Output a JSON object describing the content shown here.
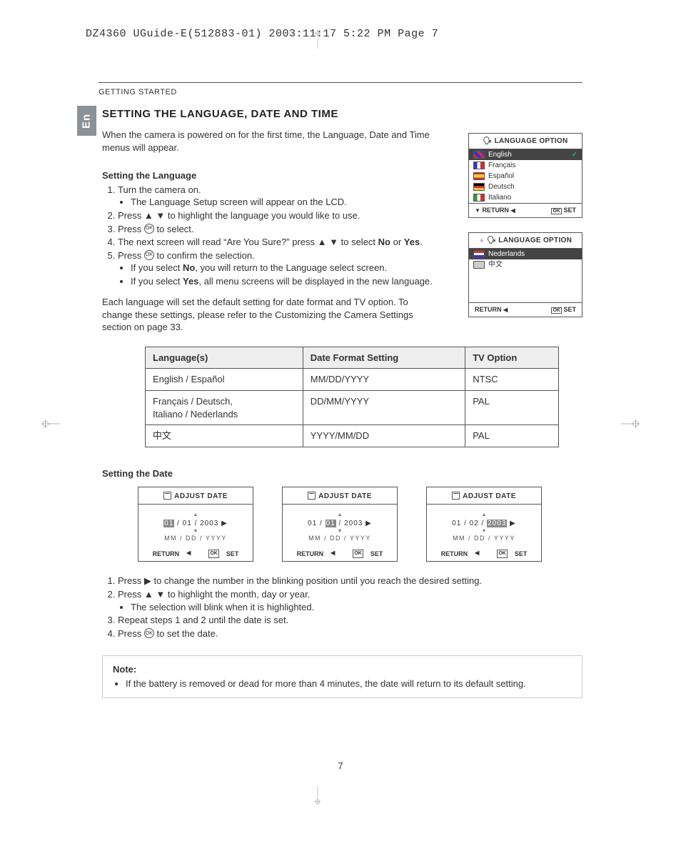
{
  "header_line": "DZ4360 UGuide-E(512883-01)  2003:11:17  5:22 PM  Page 7",
  "section_label": "GETTING STARTED",
  "en_tab": "En",
  "h2": "SETTING THE LANGUAGE, DATE AND TIME",
  "intro": "When the camera is powered on for the first time, the Language, Date and Time menus will appear.",
  "set_lang_h": "Setting the Language",
  "steps_lang": {
    "s1": "Turn the camera on.",
    "s1a": "The Language Setup screen will appear on the LCD.",
    "s2a": "Press ",
    "s2b": " to highlight the language you would like to use.",
    "s3a": "Press ",
    "s3b": " to select.",
    "s4a": "The next screen will read “Are You Sure?” press ",
    "s4b": " to select ",
    "s4no": "No",
    "s4or": " or ",
    "s4yes": "Yes",
    "s4end": ".",
    "s5a": "Press ",
    "s5b": " to confirm the selection.",
    "s5s1a": "If you select ",
    "s5s1b": ", you will return to the Language select screen.",
    "s5s2a": "If you select ",
    "s5s2b": ", all menu screens will be displayed in the new language."
  },
  "para_after": "Each language will set the default setting for date format and TV option.  To change these settings, please refer to the Customizing the Camera Settings section on page 33.",
  "table": {
    "h1": "Language(s)",
    "h2": "Date Format Setting",
    "h3": "TV Option",
    "rows": [
      {
        "c1": "English / Español",
        "c2": "MM/DD/YYYY",
        "c3": "NTSC"
      },
      {
        "c1": "Français / Deutsch,\nItaliano / Nederlands",
        "c2": "DD/MM/YYYY",
        "c3": "PAL"
      },
      {
        "c1": "中文",
        "c2": "YYYY/MM/DD",
        "c3": "PAL"
      }
    ]
  },
  "set_date_h": "Setting the Date",
  "lang_panel": {
    "title": "LANGUAGE OPTION",
    "items1": [
      "English",
      "Français",
      "Español",
      "Deutsch",
      "Italiano"
    ],
    "items2": [
      "Nederlands",
      "中文"
    ],
    "return": "RETURN",
    "set": "SET",
    "ok": "OK"
  },
  "date_panels": [
    {
      "title": "ADJUST DATE",
      "hl": "01",
      "rest": " / 01 / 2003",
      "fmt": "MM / DD / YYYY",
      "return": "RETURN",
      "set": "SET"
    },
    {
      "title": "ADJUST DATE",
      "pre": "01 / ",
      "hl": "01",
      "rest": " / 2003",
      "fmt": "MM / DD / YYYY",
      "return": "RETURN",
      "set": "SET"
    },
    {
      "title": "ADJUST DATE",
      "pre": "01 / 02 / ",
      "hl": "2003",
      "rest": "",
      "fmt": "MM / DD / YYYY",
      "return": "RETURN",
      "set": "SET"
    }
  ],
  "steps_date": {
    "s1a": "Press ",
    "s1b": " to change the number in the blinking position until you reach the desired setting.",
    "s2a": "Press ",
    "s2b": " to highlight the month, day or year.",
    "s2s1": "The selection will blink when it is highlighted.",
    "s3": "Repeat steps 1 and 2 until the date is set.",
    "s4a": "Press ",
    "s4b": " to set the date."
  },
  "note_h": "Note:",
  "note_body": "If the battery is removed or dead for more than 4 minutes, the date will return to its default setting.",
  "page_num": "7"
}
